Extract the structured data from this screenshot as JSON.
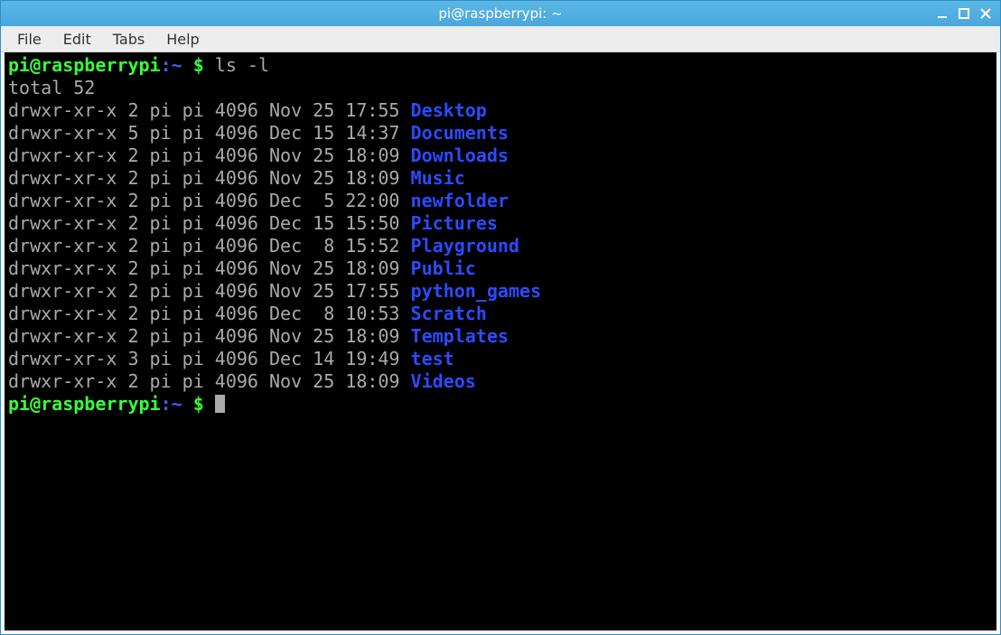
{
  "window": {
    "title": "pi@raspberrypi: ~"
  },
  "menu": {
    "file": "File",
    "edit": "Edit",
    "tabs": "Tabs",
    "help": "Help"
  },
  "prompt": {
    "userhost": "pi@raspberrypi",
    "sep": ":",
    "path": "~",
    "sym": " $ "
  },
  "command": "ls -l",
  "total_line": "total 52",
  "listing": [
    {
      "perm": "drwxr-xr-x 2 pi pi 4096 Nov 25 17:55 ",
      "name": "Desktop"
    },
    {
      "perm": "drwxr-xr-x 5 pi pi 4096 Dec 15 14:37 ",
      "name": "Documents"
    },
    {
      "perm": "drwxr-xr-x 2 pi pi 4096 Nov 25 18:09 ",
      "name": "Downloads"
    },
    {
      "perm": "drwxr-xr-x 2 pi pi 4096 Nov 25 18:09 ",
      "name": "Music"
    },
    {
      "perm": "drwxr-xr-x 2 pi pi 4096 Dec  5 22:00 ",
      "name": "newfolder"
    },
    {
      "perm": "drwxr-xr-x 2 pi pi 4096 Dec 15 15:50 ",
      "name": "Pictures"
    },
    {
      "perm": "drwxr-xr-x 2 pi pi 4096 Dec  8 15:52 ",
      "name": "Playground"
    },
    {
      "perm": "drwxr-xr-x 2 pi pi 4096 Nov 25 18:09 ",
      "name": "Public"
    },
    {
      "perm": "drwxr-xr-x 2 pi pi 4096 Nov 25 17:55 ",
      "name": "python_games"
    },
    {
      "perm": "drwxr-xr-x 2 pi pi 4096 Dec  8 10:53 ",
      "name": "Scratch"
    },
    {
      "perm": "drwxr-xr-x 2 pi pi 4096 Nov 25 18:09 ",
      "name": "Templates"
    },
    {
      "perm": "drwxr-xr-x 3 pi pi 4096 Dec 14 19:49 ",
      "name": "test"
    },
    {
      "perm": "drwxr-xr-x 2 pi pi 4096 Nov 25 18:09 ",
      "name": "Videos"
    }
  ]
}
